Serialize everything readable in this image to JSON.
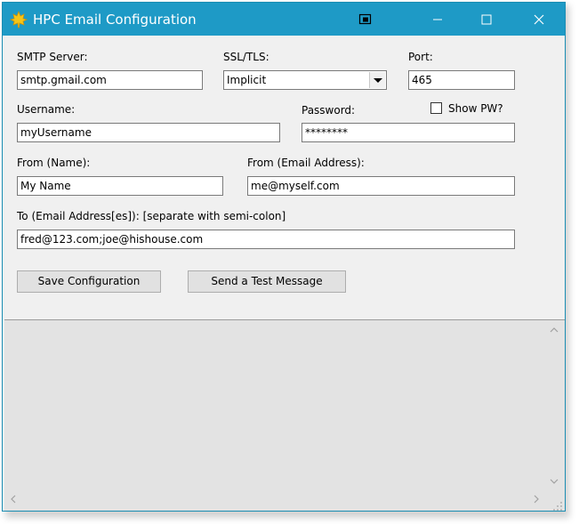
{
  "window": {
    "title": "HPC Email Configuration",
    "titlebar_color": "#1e9ac6"
  },
  "form": {
    "smtp_label": "SMTP Server:",
    "smtp_value": "smtp.gmail.com",
    "ssl_label": "SSL/TLS:",
    "ssl_value": "Implicit",
    "port_label": "Port:",
    "port_value": "465",
    "username_label": "Username:",
    "username_value": "myUsername",
    "password_label": "Password:",
    "password_value": "********",
    "show_pw_label": "Show PW?",
    "show_pw_checked": false,
    "from_name_label": "From (Name):",
    "from_name_value": "My Name",
    "from_email_label": "From (Email Address):",
    "from_email_value": "me@myself.com",
    "to_label": "To (Email Address[es]): [separate with semi-colon]",
    "to_value": "fred@123.com;joe@hishouse.com"
  },
  "buttons": {
    "save_label": "Save Configuration",
    "test_label": "Send a Test Message"
  },
  "icons": {
    "app": "maple-leaf-icon",
    "restore": "window-restore-icon",
    "minimize": "minimize-icon",
    "maximize": "maximize-icon",
    "close": "close-icon"
  }
}
